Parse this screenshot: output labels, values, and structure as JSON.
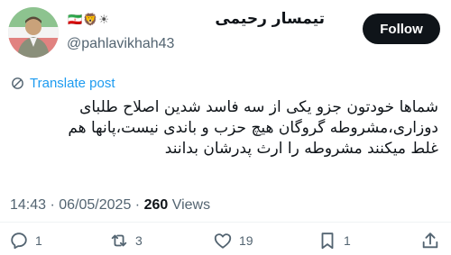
{
  "author": {
    "display_name": "تیمسار رحیمی",
    "name_emoji": "🇮🇷🦁☀",
    "handle": "@pahlavikhah43",
    "follow_label": "Follow"
  },
  "post": {
    "translate_label": "Translate post",
    "lines": [
      "شماها خودتون جزو یکی از سه فاسد شدین اصلاح طلبای",
      "دوزاری،مشروطه گروگان هیچ حزب و باندی نیست،پانها هم",
      "غلط میکنند مشروطه را ارث پدرشان بدانند"
    ]
  },
  "meta": {
    "time": "14:43",
    "separator": " · ",
    "date": "06/05/2025",
    "views_count": "260",
    "views_label": " Views"
  },
  "actions": {
    "replies": "1",
    "reposts": "3",
    "likes": "19",
    "bookmarks": "1"
  },
  "colors": {
    "accent": "#1d9bf0",
    "text": "#0f1419",
    "muted": "#536471"
  },
  "icons": [
    "translate-icon",
    "reply-icon",
    "repost-icon",
    "like-icon",
    "bookmark-icon",
    "share-icon"
  ]
}
